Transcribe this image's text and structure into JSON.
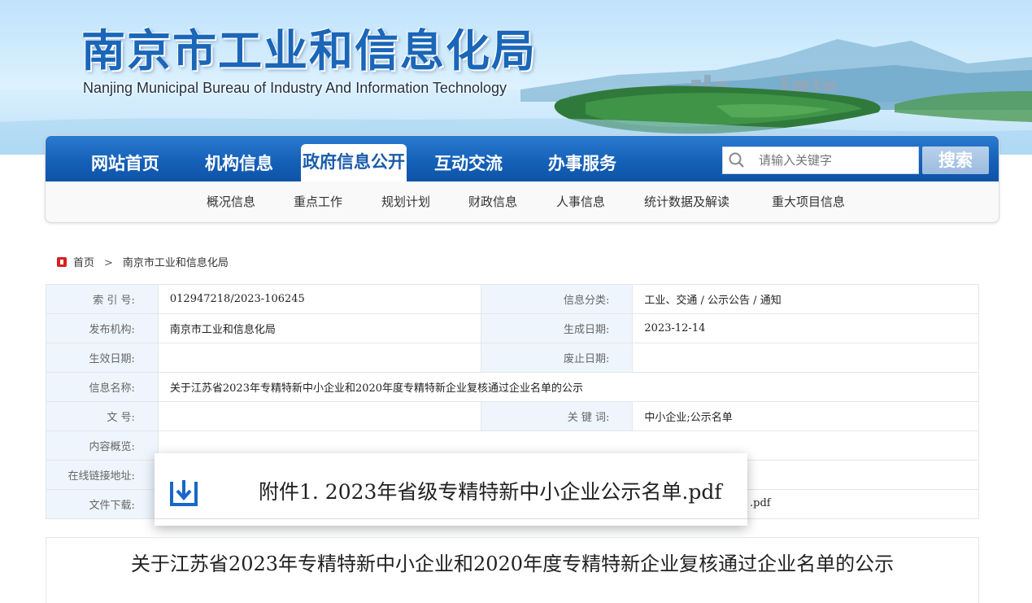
{
  "site": {
    "title": "南京市工业和信息化局",
    "subtitle": "Nanjing Municipal Bureau of Industry And Information Technology"
  },
  "nav": {
    "items": [
      {
        "label": "网站首页"
      },
      {
        "label": "机构信息"
      },
      {
        "label": "政府信息公开",
        "active": true
      },
      {
        "label": "互动交流"
      },
      {
        "label": "办事服务"
      }
    ],
    "search_placeholder": "请输入关键字",
    "search_button": "搜索",
    "sub_items": [
      {
        "label": "概况信息"
      },
      {
        "label": "重点工作"
      },
      {
        "label": "规划计划"
      },
      {
        "label": "财政信息"
      },
      {
        "label": "人事信息"
      },
      {
        "label": "统计数据及解读"
      },
      {
        "label": "重大项目信息"
      }
    ]
  },
  "breadcrumb": {
    "home": "首页",
    "separator": ">",
    "current": "南京市工业和信息化局"
  },
  "info_table": {
    "index_label": "索  引  号:",
    "index_value": "012947218/2023-106245",
    "category_label": "信息分类:",
    "category_value": "工业、交通 / 公示公告 / 通知",
    "publisher_label": "发布机构:",
    "publisher_value": "南京市工业和信息化局",
    "created_label": "生成日期:",
    "created_value": "2023-12-14",
    "effective_label": "生效日期:",
    "effective_value": "",
    "expire_label": "废止日期:",
    "expire_value": "",
    "name_label": "信息名称:",
    "name_value": "关于江苏省2023年专精特新中小企业和2020年度专精特新企业复核通过企业名单的公示",
    "doc_no_label": "文      号:",
    "doc_no_value": "",
    "keywords_label": "关  键  词:",
    "keywords_value": "中小企业;公示名单",
    "summary_label": "内容概览:",
    "online_link_label": "在线链接地址:",
    "download_label": "文件下载:"
  },
  "attachment": {
    "filename": "附件1. 2023年省级专精特新中小企业公示名单.pdf",
    "tail": ".pdf"
  },
  "article": {
    "title": "关于江苏省2023年专精特新中小企业和2020年度专精特新企业复核通过企业名单的公示"
  },
  "colors": {
    "nav_blue": "#145fb6",
    "title_blue": "#1a66b8",
    "label_bg": "#eef5fc",
    "breadcrumb_red": "#d82020"
  }
}
